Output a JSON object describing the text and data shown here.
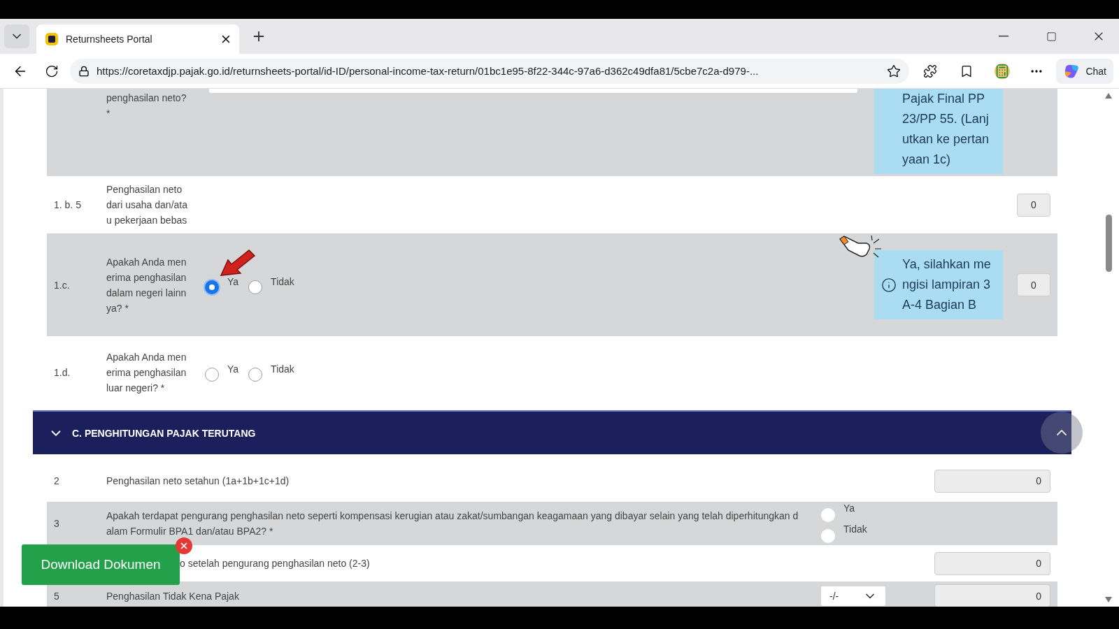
{
  "browser": {
    "tab": {
      "title": "Returnsheets Portal"
    },
    "url": "https://coretaxdjp.pajak.go.id/returnsheets-portal/id-ID/personal-income-tax-return/01bc1e95-8f22-344c-97a6-d362c49dfa81/5cbe7c2a-d979-...",
    "chat_button": "Chat"
  },
  "rows_top": [
    {
      "kind": "question",
      "shaded": true,
      "label": "penghasilan neto?\n*",
      "tooltip": {
        "text": "Pajak Final PP 23/PP 55. (Lanjutkan ke pertanyaan 1c)",
        "icon": false
      }
    },
    {
      "kind": "question",
      "shaded": false,
      "number": "1. b. 5",
      "label": "Penghasilan neto dari usaha dan/atau pekerjaan bebas",
      "value": "0"
    },
    {
      "kind": "question",
      "shaded": true,
      "number": "1.c.",
      "label": "Apakah Anda menerima penghasilan dalam negeri lainnya? *",
      "options": [
        {
          "label": "Ya",
          "selected": true
        },
        {
          "label": "Tidak",
          "selected": false
        }
      ],
      "tooltip": {
        "text": "Ya, silahkan mengisi lampiran 3A-4 Bagian B",
        "icon": true
      },
      "value": "0"
    },
    {
      "kind": "question",
      "shaded": false,
      "number": "1.d.",
      "label": "Apakah Anda menerima penghasilan luar negeri? *",
      "options": [
        {
          "label": "Ya",
          "selected": false
        },
        {
          "label": "Tidak",
          "selected": false
        }
      ]
    }
  ],
  "section": {
    "title": "C. PENGHITUNGAN PAJAK TERUTANG",
    "expanded": true
  },
  "rows_c": [
    {
      "kind": "amount",
      "shaded": false,
      "number": "2",
      "label": "Penghasilan neto setahun (1a+1b+1c+1d)",
      "value": "0"
    },
    {
      "kind": "choice",
      "shaded": true,
      "number": "3",
      "label": "Apakah terdapat pengurang penghasilan neto seperti kompensasi kerugian atau zakat/sumbangan keagamaan yang dibayar selain yang telah diperhitungkan dalam Formulir BPA1 dan/atau BPA2? *",
      "options": [
        {
          "label": "Ya",
          "selected": false
        },
        {
          "label": "Tidak",
          "selected": false
        }
      ]
    },
    {
      "kind": "amount",
      "shaded": false,
      "covered": true,
      "label": "o setelah pengurang penghasilan neto (2-3)",
      "value": "0"
    },
    {
      "kind": "amount",
      "shaded": true,
      "number": "5",
      "label": "Penghasilan Tidak Kena Pajak",
      "select": "-/-",
      "value": "0"
    }
  ],
  "download_button": {
    "label": "Download Dokumen"
  }
}
